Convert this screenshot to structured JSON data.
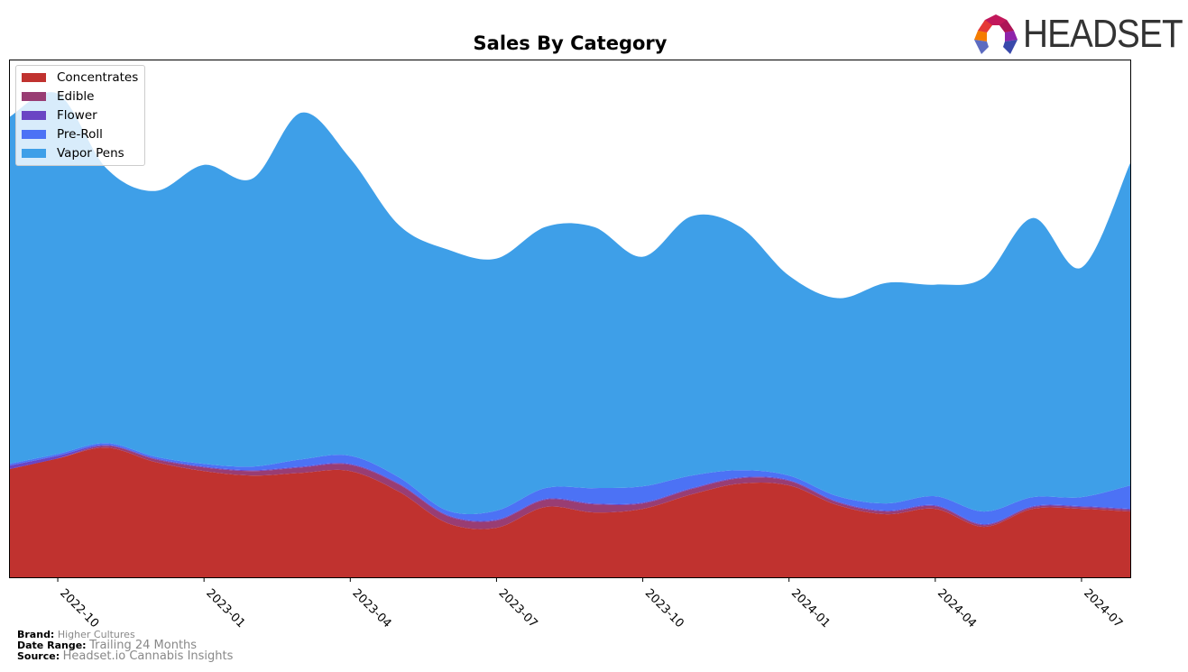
{
  "header": {
    "logo_text": "HEADSET"
  },
  "footer": {
    "brand_label": "Brand:",
    "brand_value": "Higher Cultures",
    "date_range_label": "Date Range:",
    "date_range_value": "Trailing 24 Months",
    "source_label": "Source:",
    "source_value": "Headset.io Cannabis Insights"
  },
  "chart_data": {
    "type": "area",
    "stacked": true,
    "title": "Sales By Category",
    "xlabel": "",
    "ylabel": "",
    "x_ticks": [
      "2022-10",
      "2023-01",
      "2023-04",
      "2023-07",
      "2023-10",
      "2024-01",
      "2024-04",
      "2024-07"
    ],
    "x": [
      "2022-09",
      "2022-10",
      "2022-11",
      "2022-12",
      "2023-01",
      "2023-02",
      "2023-03",
      "2023-04",
      "2023-05",
      "2023-06",
      "2023-07",
      "2023-08",
      "2023-09",
      "2023-10",
      "2023-11",
      "2023-12",
      "2024-01",
      "2024-02",
      "2024-03",
      "2024-04",
      "2024-05",
      "2024-06",
      "2024-07",
      "2024-08"
    ],
    "ylim": [
      0,
      575
    ],
    "y_units": "relative sales (no axis labels shown)",
    "legend_position": "top-left",
    "grid": false,
    "series": [
      {
        "name": "Concentrates",
        "color": "#c0322f",
        "values": [
          120,
          132,
          144,
          128,
          118,
          113,
          116,
          118,
          95,
          60,
          55,
          78,
          72,
          76,
          92,
          104,
          102,
          80,
          70,
          76,
          56,
          76,
          76,
          73
        ]
      },
      {
        "name": "Edible",
        "color": "#993d73",
        "values": [
          0,
          0,
          2,
          3,
          4,
          5,
          6,
          7,
          8,
          8,
          8,
          8,
          9,
          6,
          6,
          6,
          5,
          3,
          3,
          3,
          2,
          2,
          2,
          2
        ]
      },
      {
        "name": "Flower",
        "color": "#6a45c4",
        "values": [
          4,
          3,
          1,
          1,
          1,
          1,
          1,
          1,
          1,
          1,
          1,
          1,
          1,
          1,
          1,
          1,
          1,
          1,
          1,
          1,
          1,
          1,
          1,
          1
        ]
      },
      {
        "name": "Pre-Roll",
        "color": "#4c72f5",
        "values": [
          2,
          2,
          2,
          2,
          3,
          4,
          8,
          9,
          7,
          5,
          10,
          12,
          17,
          18,
          14,
          8,
          5,
          6,
          8,
          10,
          14,
          10,
          10,
          26
        ]
      },
      {
        "name": "Vapor Pens",
        "color": "#3e9fe8",
        "values": [
          385,
          400,
          305,
          295,
          332,
          320,
          385,
          330,
          280,
          290,
          280,
          290,
          290,
          255,
          288,
          270,
          222,
          220,
          245,
          235,
          260,
          310,
          255,
          358
        ]
      }
    ]
  }
}
